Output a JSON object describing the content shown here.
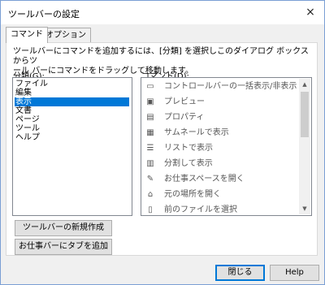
{
  "window": {
    "title": "ツールバーの設定",
    "close_icon": "×"
  },
  "tabs": [
    {
      "label": "コマンド"
    },
    {
      "label": "オプション"
    }
  ],
  "description": {
    "line1": "ツールバーにコマンドを追加するには、[分類] を選択しこのダイアログ ボックスからツ",
    "line2": "ール バーにコマンドをドラッグして移動します。"
  },
  "categories_label": "分類(G):",
  "commands_label": "コマンド(D):",
  "categories": [
    "ファイル",
    "編集",
    "表示",
    "文書",
    "ページ",
    "ツール",
    "ヘルプ"
  ],
  "selected_category": "表示",
  "commands": [
    {
      "label": "コントロールバーの一括表示/非表示",
      "icon": "toggle-toolbars-icon"
    },
    {
      "label": "プレビュー",
      "icon": "preview-icon"
    },
    {
      "label": "プロパティ",
      "icon": "properties-icon"
    },
    {
      "label": "サムネールで表示",
      "icon": "thumbnail-view-icon"
    },
    {
      "label": "リストで表示",
      "icon": "list-view-icon"
    },
    {
      "label": "分割して表示",
      "icon": "split-view-icon"
    },
    {
      "label": "お仕事スペースを開く",
      "icon": "open-workspace-icon"
    },
    {
      "label": "元の場所を開く",
      "icon": "open-original-location-icon"
    },
    {
      "label": "前のファイルを選択",
      "icon": "previous-file-icon"
    }
  ],
  "buttons": {
    "new_toolbar": "ツールバーの新規作成",
    "add_tab": "お仕事バーにタブを追加",
    "close": "閉じる",
    "help": "Help"
  }
}
